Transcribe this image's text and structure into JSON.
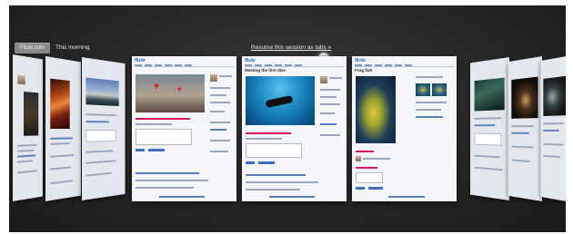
{
  "header": {
    "tab_flickr": "Flickr.com",
    "tab_morning": "This morning",
    "resume_link": "Resume this session as tabs »",
    "close_icon": "close-icon"
  },
  "cards": [
    {
      "logo": "flickr",
      "title": "",
      "photo": "ph-hearts"
    },
    {
      "logo": "flickr",
      "title": "Meeting the first dive",
      "photo": "ph-diver"
    },
    {
      "logo": "flickr",
      "title": "Frog fish",
      "photo": "ph-frog"
    }
  ]
}
